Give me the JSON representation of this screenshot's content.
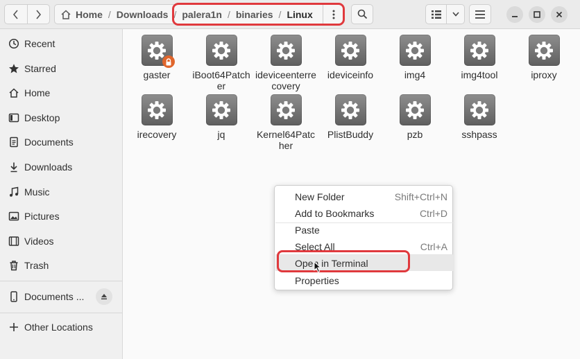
{
  "path": {
    "home": "Home",
    "segments": [
      "Downloads",
      "palera1n",
      "binaries"
    ],
    "current": "Linux"
  },
  "sidebar": {
    "items": [
      {
        "label": "Recent",
        "icon": "clock-icon"
      },
      {
        "label": "Starred",
        "icon": "star-icon"
      },
      {
        "label": "Home",
        "icon": "home-icon"
      },
      {
        "label": "Desktop",
        "icon": "desktop-icon"
      },
      {
        "label": "Documents",
        "icon": "document-icon"
      },
      {
        "label": "Downloads",
        "icon": "download-icon"
      },
      {
        "label": "Music",
        "icon": "music-icon"
      },
      {
        "label": "Pictures",
        "icon": "picture-icon"
      },
      {
        "label": "Videos",
        "icon": "video-icon"
      },
      {
        "label": "Trash",
        "icon": "trash-icon"
      }
    ],
    "device": {
      "label": "Documents ...",
      "icon": "phone-icon"
    },
    "other": {
      "label": "Other Locations",
      "icon": "plus-icon"
    }
  },
  "files": [
    {
      "name": "gaster",
      "locked": true
    },
    {
      "name": "iBoot64Patcher"
    },
    {
      "name": "ideviceenterrecovery"
    },
    {
      "name": "ideviceinfo"
    },
    {
      "name": "img4"
    },
    {
      "name": "img4tool"
    },
    {
      "name": "iproxy"
    },
    {
      "name": "irecovery"
    },
    {
      "name": "jq"
    },
    {
      "name": "Kernel64Patcher"
    },
    {
      "name": "PlistBuddy"
    },
    {
      "name": "pzb"
    },
    {
      "name": "sshpass"
    }
  ],
  "context_menu": {
    "new_folder": {
      "label": "New Folder",
      "shortcut": "Shift+Ctrl+N"
    },
    "add_bookmarks": {
      "label": "Add to Bookmarks",
      "shortcut": "Ctrl+D"
    },
    "paste": {
      "label": "Paste"
    },
    "select_all": {
      "label": "Select All",
      "shortcut": "Ctrl+A"
    },
    "open_terminal": {
      "label": "Open in Terminal"
    },
    "properties": {
      "label": "Properties"
    }
  },
  "colors": {
    "highlight": "#e0393d",
    "file_icon": "#7a7a7a",
    "lock_badge": "#e0662c"
  }
}
